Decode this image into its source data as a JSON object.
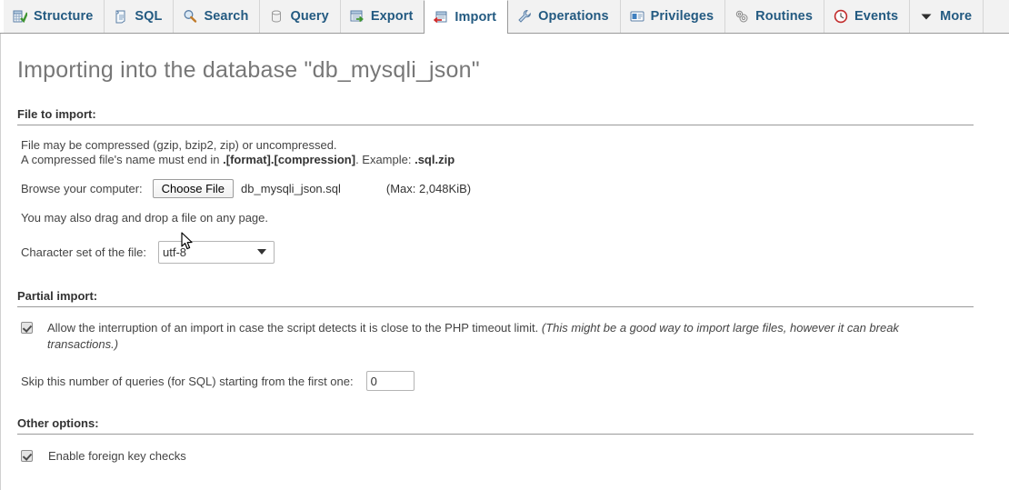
{
  "tabs": [
    {
      "label": "Structure",
      "icon": "structure-icon",
      "active": false
    },
    {
      "label": "SQL",
      "icon": "sql-icon",
      "active": false
    },
    {
      "label": "Search",
      "icon": "search-icon",
      "active": false
    },
    {
      "label": "Query",
      "icon": "query-icon",
      "active": false
    },
    {
      "label": "Export",
      "icon": "export-icon",
      "active": false
    },
    {
      "label": "Import",
      "icon": "import-icon",
      "active": true
    },
    {
      "label": "Operations",
      "icon": "wrench-icon",
      "active": false
    },
    {
      "label": "Privileges",
      "icon": "privileges-icon",
      "active": false
    },
    {
      "label": "Routines",
      "icon": "gears-icon",
      "active": false
    },
    {
      "label": "Events",
      "icon": "clock-icon",
      "active": false
    },
    {
      "label": "More",
      "icon": "chevron-down-icon",
      "active": false
    }
  ],
  "page": {
    "title": "Importing into the database \"db_mysqli_json\""
  },
  "file_to_import": {
    "heading": "File to import:",
    "note_line1": "File may be compressed (gzip, bzip2, zip) or uncompressed.",
    "note_line2_prefix": "A compressed file's name must end in ",
    "note_line2_bold1": ".[format].[compression]",
    "note_line2_mid": ". Example: ",
    "note_line2_bold2": ".sql.zip",
    "browse_label": "Browse your computer:",
    "choose_file_button": "Choose File",
    "selected_file": "db_mysqli_json.sql",
    "max_size": "(Max: 2,048KiB)",
    "drag_drop_hint": "You may also drag and drop a file on any page.",
    "charset_label": "Character set of the file:",
    "charset_value": "utf-8",
    "charset_options": [
      "utf-8"
    ]
  },
  "partial_import": {
    "heading": "Partial import:",
    "allow_interrupt_checked": true,
    "allow_interrupt_label": "Allow the interruption of an import in case the script detects it is close to the PHP timeout limit.",
    "allow_interrupt_note": "(This might be a good way to import large files, however it can break transactions.)",
    "skip_label": "Skip this number of queries (for SQL) starting from the first one:",
    "skip_value": "0"
  },
  "other_options": {
    "heading": "Other options:",
    "foreign_key_checked": true,
    "foreign_key_label": "Enable foreign key checks"
  },
  "colors": {
    "tab_text": "#235a81",
    "title_text": "#777777",
    "body_text": "#444444",
    "rule": "#9a9a9a"
  }
}
